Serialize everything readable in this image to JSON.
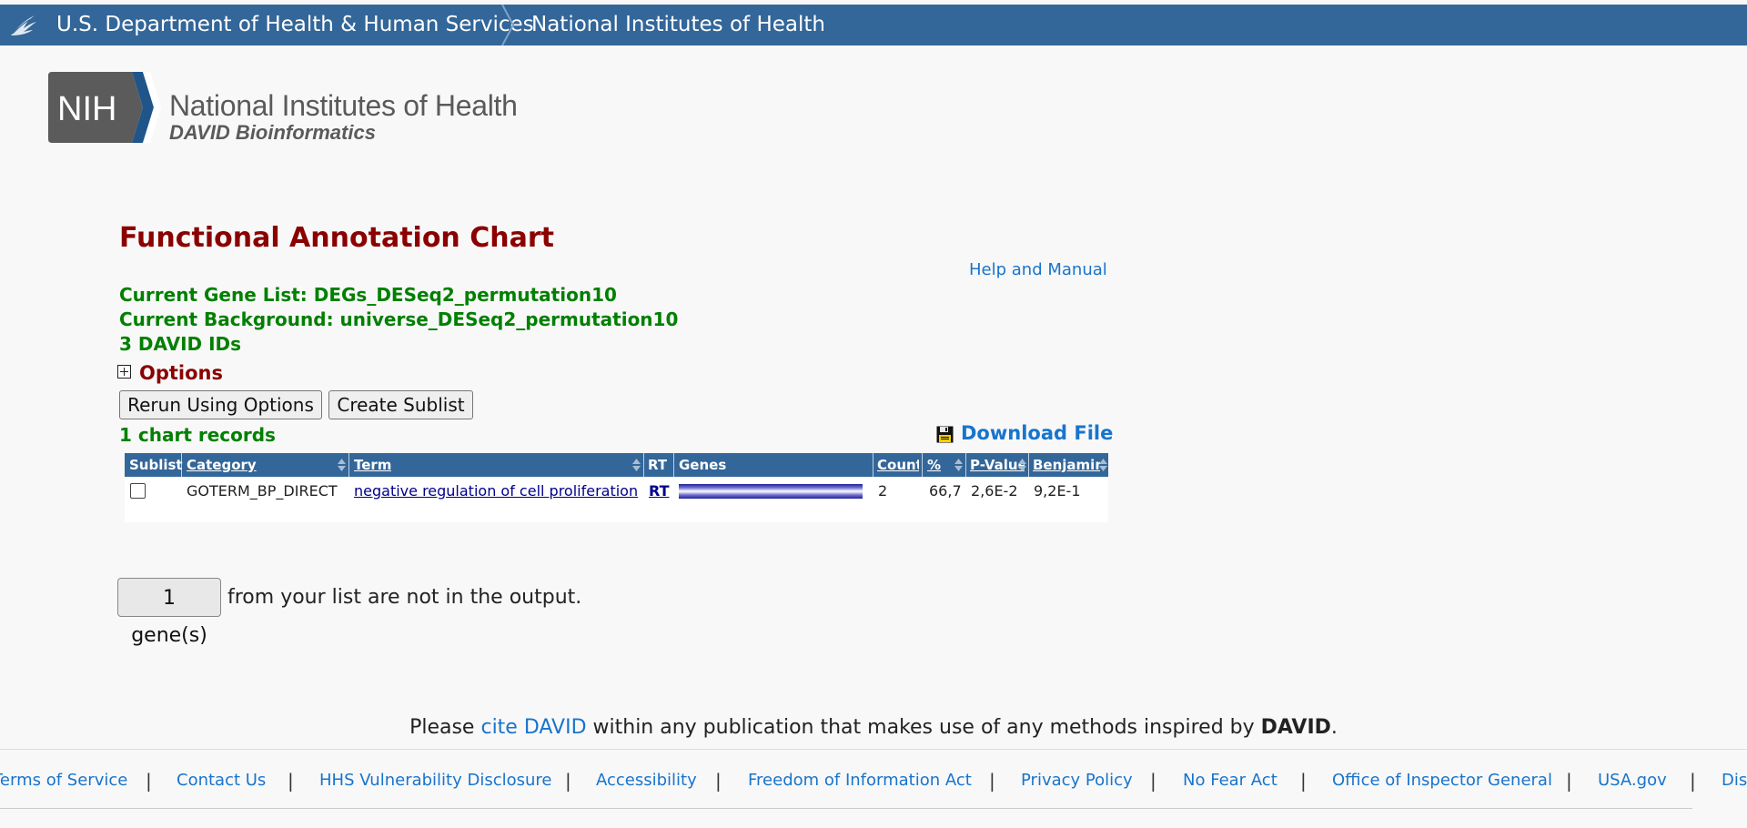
{
  "hhs_bar": {
    "department": "U.S. Department of Health & Human Services",
    "agency": "National Institutes of Health",
    "bg_color": "#336699"
  },
  "logo": {
    "badge": "NIH",
    "title": "National Institutes of Health",
    "subtitle": "DAVID Bioinformatics"
  },
  "page": {
    "title": "Functional Annotation Chart",
    "help_link": "Help and Manual",
    "gene_list": "Current Gene List: DEGs_DESeq2_permutation10",
    "background": "Current Background: universe_DESeq2_permutation10",
    "id_count": "3 DAVID IDs",
    "options_label": "Options",
    "rerun_button": "Rerun Using Options",
    "sublist_button": "Create Sublist",
    "records": "1 chart records",
    "download_link": "Download File"
  },
  "table": {
    "headers": {
      "sublist": "Sublist",
      "category": "Category",
      "term": "Term",
      "rt": "RT",
      "genes": "Genes",
      "count": "Count",
      "percent": "%",
      "pvalue": "P-Value",
      "benjamini": "Benjamini"
    },
    "rows": [
      {
        "checked": false,
        "category": "GOTERM_BP_DIRECT",
        "term": "negative regulation of cell proliferation",
        "rt": "RT",
        "count": "2",
        "percent": "66,7",
        "pvalue": "2,6E-2",
        "benjamini": "9,2E-1"
      }
    ]
  },
  "not_in_output": {
    "button": "1 gene(s)",
    "text": "from your list are not in the output."
  },
  "citation": {
    "prefix": "Please",
    "link": "cite DAVID",
    "middle": "within any publication that makes use of any methods inspired by",
    "bold": "DAVID",
    "suffix": "."
  },
  "footer": {
    "links": [
      "Terms of Service",
      "Contact Us",
      "HHS Vulnerability Disclosure",
      "Accessibility",
      "Freedom of Information Act",
      "Privacy Policy",
      "No Fear Act",
      "Office of Inspector General",
      "USA.gov",
      "Disclaimer"
    ],
    "separator": "|"
  },
  "colors": {
    "title_red": "#8b0000",
    "info_green": "#008000",
    "link_blue": "#1874cd",
    "table_header": "#336699"
  },
  "icons": [
    "hhs-eagle-icon",
    "nih-chevron-logo",
    "options-expand-icon",
    "floppy-disk-icon",
    "sort-arrows-icon"
  ]
}
